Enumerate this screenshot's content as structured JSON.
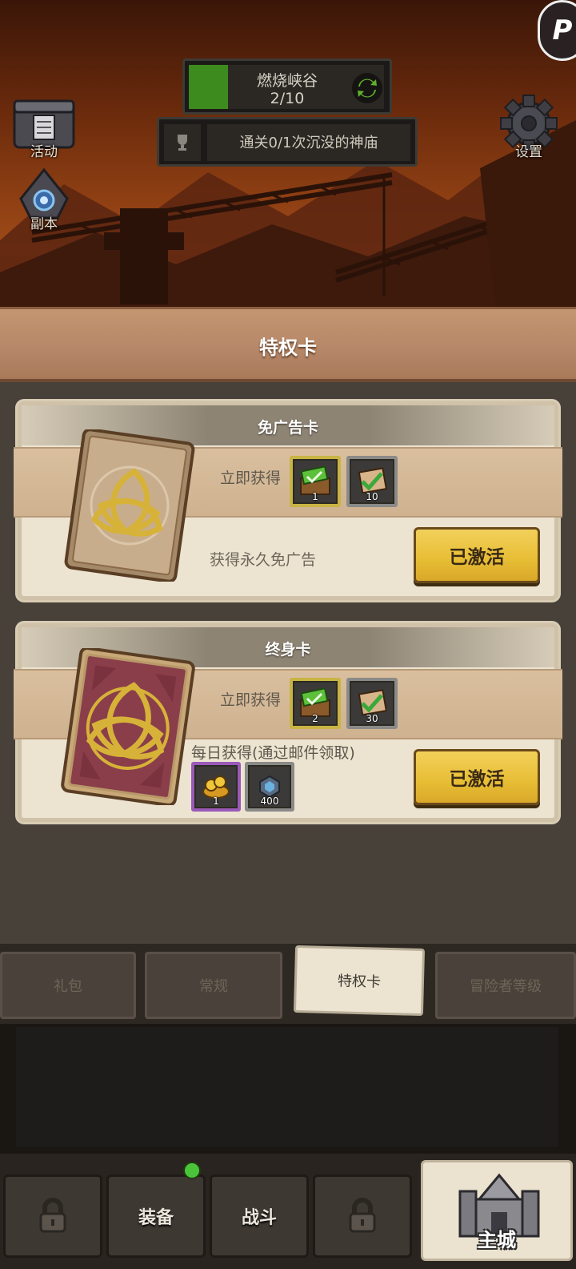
{
  "hud": {
    "stage": {
      "name": "燃烧峡谷",
      "count": "2/10",
      "progress": 0.2
    },
    "quest": {
      "text": "通关0/1次沉没的神庙"
    },
    "left_icons": [
      {
        "label": "活动",
        "icon": "calendar-icon"
      },
      {
        "label": "副本",
        "icon": "portal-icon"
      }
    ],
    "settings": {
      "label": "设置",
      "icon": "gear-icon"
    }
  },
  "header": {
    "title": "特权卡"
  },
  "cards": [
    {
      "title": "免广告卡",
      "instant_label": "立即获得",
      "instant_items": [
        {
          "icon": "ticket-chest-icon",
          "qty": "1",
          "frame": "gold"
        },
        {
          "icon": "ticket-icon",
          "qty": "10",
          "frame": "grey"
        }
      ],
      "description": "获得永久免广告",
      "button": "已激活"
    },
    {
      "title": "终身卡",
      "instant_label": "立即获得",
      "instant_items": [
        {
          "icon": "ticket-chest-icon",
          "qty": "2",
          "frame": "gold"
        },
        {
          "icon": "ticket-icon",
          "qty": "30",
          "frame": "grey"
        }
      ],
      "daily_label": "每日获得(通过邮件领取)",
      "daily_items": [
        {
          "icon": "gold-pile-icon",
          "qty": "1",
          "frame": "purple"
        },
        {
          "icon": "gem-icon",
          "qty": "400",
          "frame": "grey"
        }
      ],
      "button": "已激活"
    }
  ],
  "shop_tabs": [
    {
      "label": "礼包",
      "active": false
    },
    {
      "label": "常规",
      "active": false
    },
    {
      "label": "特权卡",
      "active": true
    },
    {
      "label": "冒险者等级",
      "active": false
    }
  ],
  "bottom_nav": [
    {
      "label": "",
      "icon": "lock-icon",
      "locked": true
    },
    {
      "label": "装备",
      "badge": true
    },
    {
      "label": "战斗"
    },
    {
      "label": "",
      "icon": "lock-icon",
      "locked": true
    },
    {
      "label": "主城",
      "icon": "castle-icon",
      "active": true
    }
  ],
  "colors": {
    "accent_yellow": "#e7bd34",
    "panel_bg": "#48413a",
    "card_bg": "#ece3d1",
    "progress_green": "#3d8a1e",
    "badge_green": "#4cc43a"
  }
}
